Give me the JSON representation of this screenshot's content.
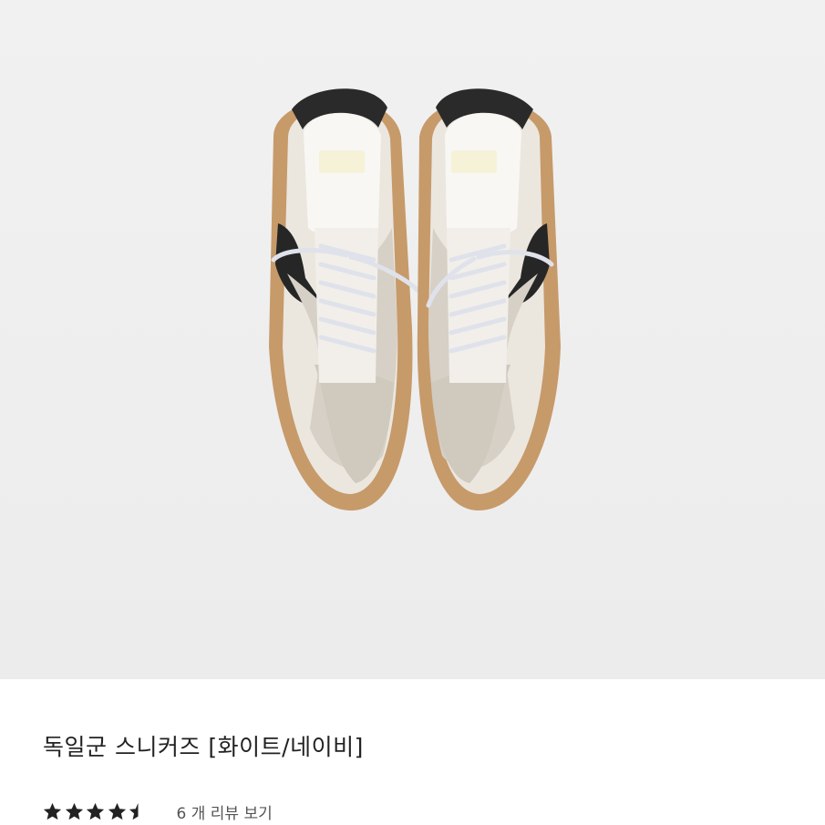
{
  "product": {
    "title": "독일군 스니커즈 [화이트/네이비]",
    "image_alt": "product-photo-sneakers"
  },
  "rating": {
    "value": 4.5,
    "max": 5,
    "star_color": "#222222",
    "review_link": "6 개 리뷰 보기"
  }
}
